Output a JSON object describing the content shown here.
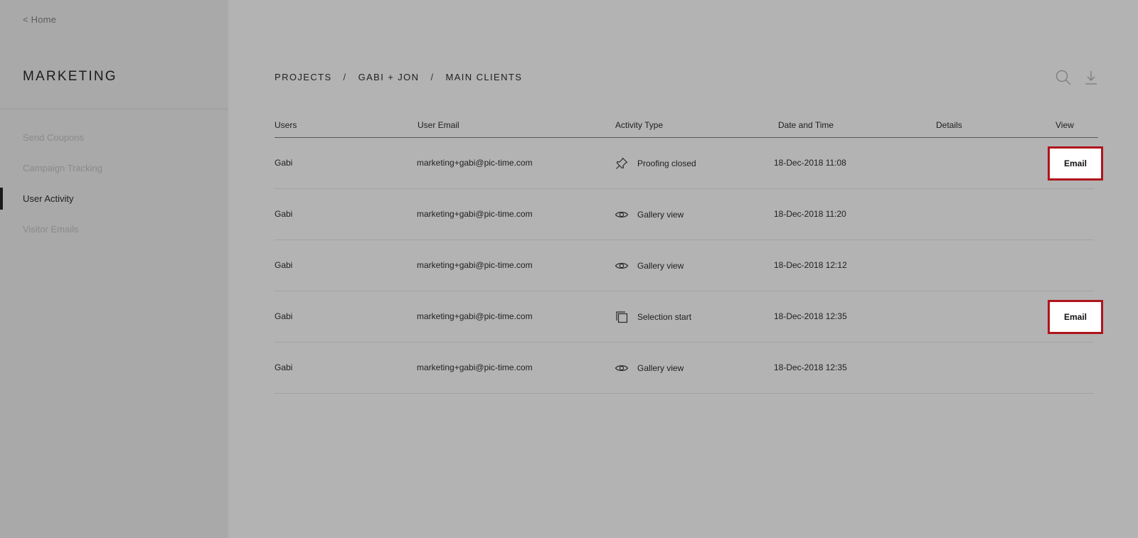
{
  "sidebar": {
    "home_label": "< Home",
    "title": "MARKETING",
    "items": [
      {
        "label": "Send Coupons",
        "active": false
      },
      {
        "label": "Campaign Tracking",
        "active": false
      },
      {
        "label": "User Activity",
        "active": true
      },
      {
        "label": "Visitor Emails",
        "active": false
      }
    ]
  },
  "breadcrumb": {
    "items": [
      "PROJECTS",
      "GABI + JON",
      "MAIN CLIENTS"
    ],
    "separator": "/"
  },
  "toolbar": {
    "search_icon": "search-icon",
    "download_icon": "download-icon"
  },
  "table": {
    "headers": [
      "Users",
      "User Email",
      "Activity Type",
      "Date and Time",
      "Details",
      "View"
    ],
    "rows": [
      {
        "user": "Gabi",
        "email": "marketing+gabi@pic-time.com",
        "activity_icon": "pin-icon",
        "activity": "Proofing closed",
        "datetime": "18-Dec-2018 11:08",
        "details": "",
        "view": "Email"
      },
      {
        "user": "Gabi",
        "email": "marketing+gabi@pic-time.com",
        "activity_icon": "eye-icon",
        "activity": "Gallery view",
        "datetime": "18-Dec-2018 11:20",
        "details": "",
        "view": ""
      },
      {
        "user": "Gabi",
        "email": "marketing+gabi@pic-time.com",
        "activity_icon": "eye-icon",
        "activity": "Gallery view",
        "datetime": "18-Dec-2018 12:12",
        "details": "",
        "view": ""
      },
      {
        "user": "Gabi",
        "email": "marketing+gabi@pic-time.com",
        "activity_icon": "copy-icon",
        "activity": "Selection start",
        "datetime": "18-Dec-2018 12:35",
        "details": "",
        "view": "Email"
      },
      {
        "user": "Gabi",
        "email": "marketing+gabi@pic-time.com",
        "activity_icon": "eye-icon",
        "activity": "Gallery view",
        "datetime": "18-Dec-2018 12:35",
        "details": "",
        "view": ""
      }
    ]
  },
  "colors": {
    "background": "#b3b3b3",
    "sidebar": "#a9a9a9",
    "email_button_border": "#b0141c"
  }
}
